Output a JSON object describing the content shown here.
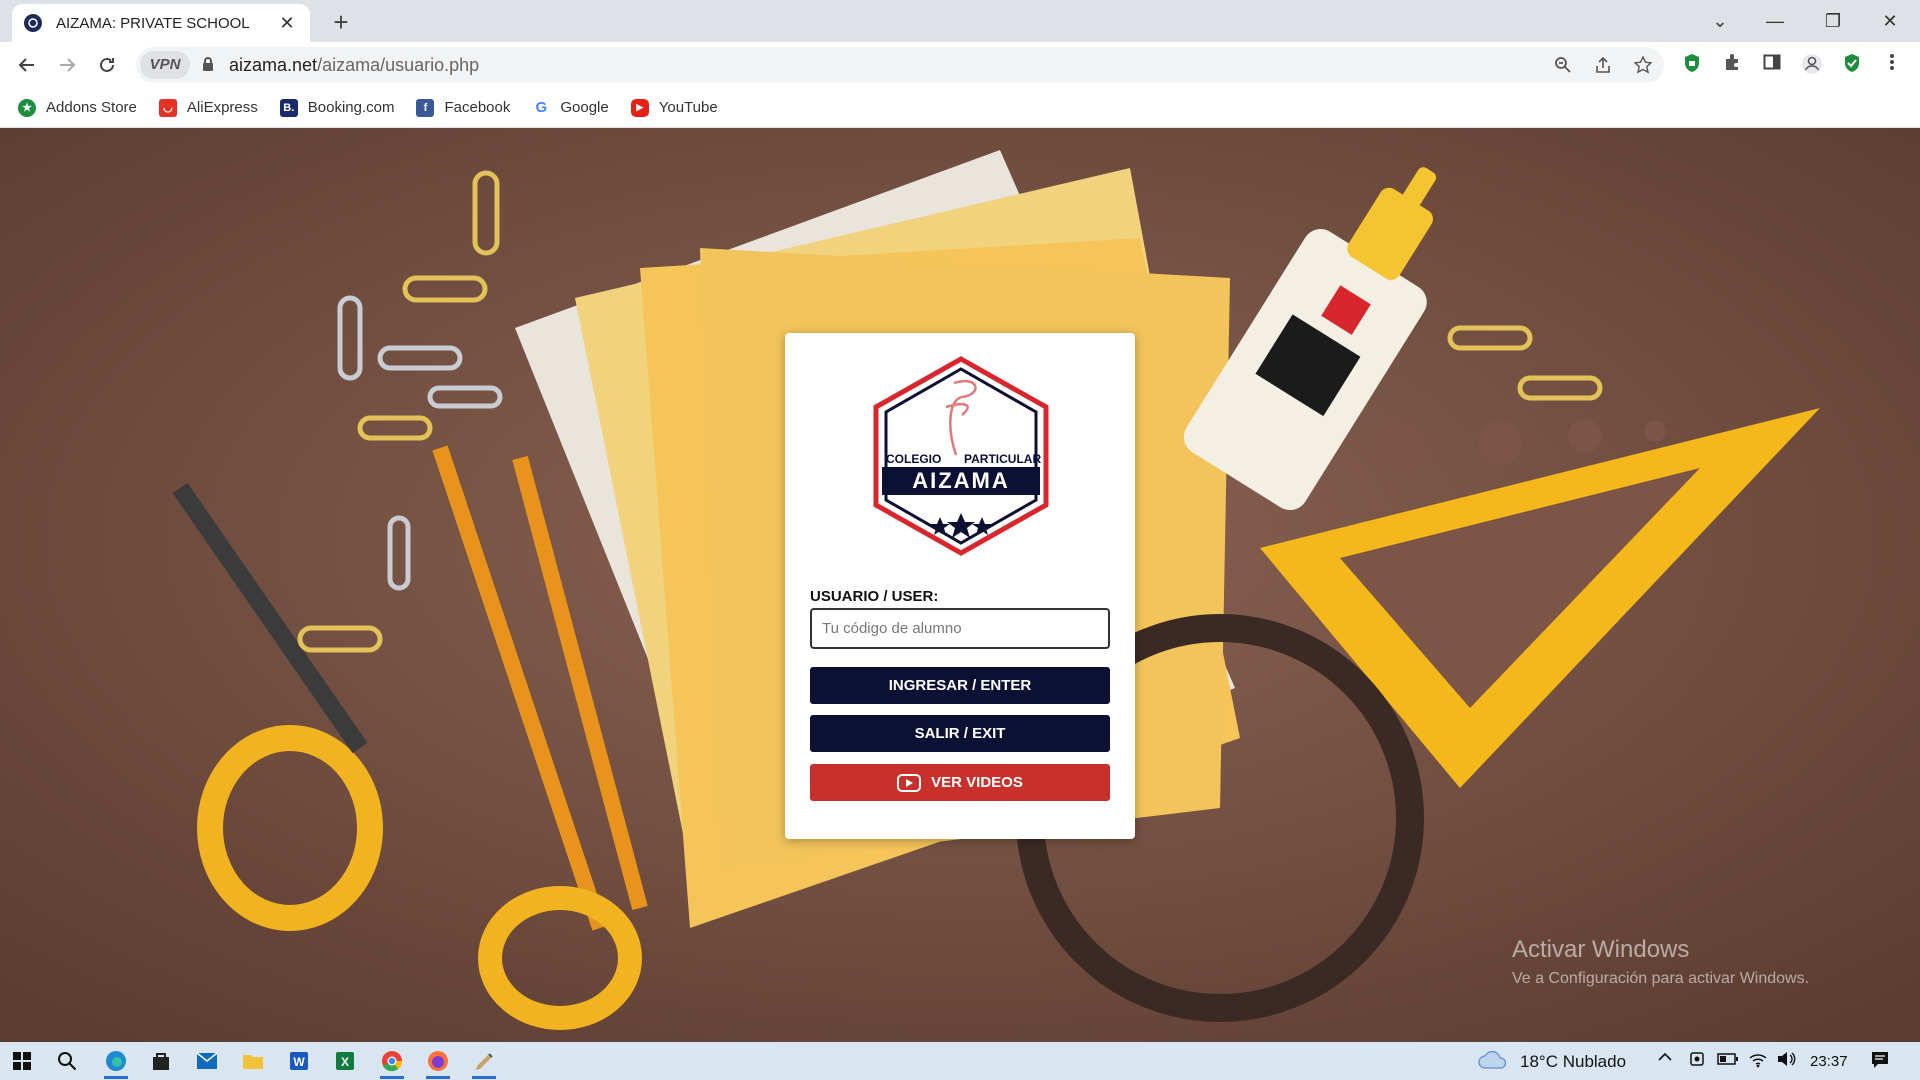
{
  "browser": {
    "tab_title": "AIZAMA: PRIVATE SCHOOL",
    "tab_close": "✕",
    "new_tab": "+",
    "vpn_label": "VPN",
    "url_host": "aizama.net",
    "url_path": "/aizama/usuario.php",
    "window_controls": {
      "collapse": "⌄",
      "minimize": "—",
      "restore": "❐",
      "close": "✕"
    }
  },
  "bookmarks": [
    {
      "label": "Addons Store",
      "icon": "addons-icon",
      "color": "#1e8e3e"
    },
    {
      "label": "AliExpress",
      "icon": "aliexpress-icon",
      "color": "#e43225"
    },
    {
      "label": "Booking.com",
      "icon": "booking-icon",
      "color": "#1a2b6b"
    },
    {
      "label": "Facebook",
      "icon": "facebook-icon",
      "color": "#3b5998"
    },
    {
      "label": "Google",
      "icon": "google-icon",
      "color": "#4285f4"
    },
    {
      "label": "YouTube",
      "icon": "youtube-icon",
      "color": "#e62117"
    }
  ],
  "login": {
    "logo_top": "COLEGIO",
    "logo_top2": "PARTICULAR",
    "logo_name": "AIZAMA",
    "user_label": "USUARIO / USER:",
    "user_placeholder": "Tu código de alumno",
    "enter_button": "INGRESAR / ENTER",
    "exit_button": "SALIR / EXIT",
    "videos_button": "VER VIDEOS",
    "colors": {
      "navy": "#0c1033",
      "red": "#c8302c"
    }
  },
  "watermark": {
    "title": "Activar Windows",
    "subtitle": "Ve a Configuración para activar Windows."
  },
  "taskbar": {
    "weather": "18°C  Nublado",
    "time": "23:37"
  }
}
